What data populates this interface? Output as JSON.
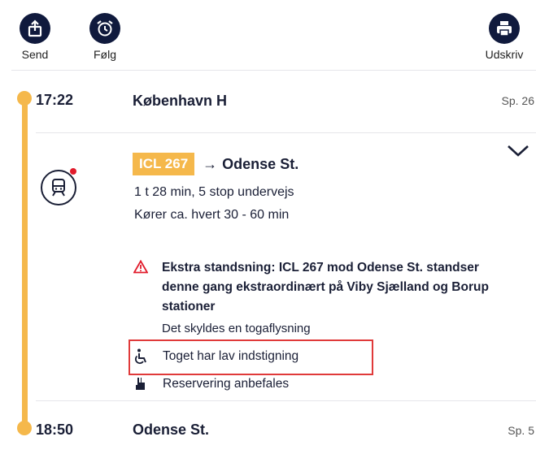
{
  "toolbar": {
    "send_label": "Send",
    "follow_label": "Følg",
    "print_label": "Udskriv"
  },
  "departure": {
    "time": "17:22",
    "station": "København H",
    "track": "Sp. 26"
  },
  "leg": {
    "train_badge": "ICL 267",
    "arrow": "→",
    "destination": "Odense St.",
    "duration": "1 t 28 min, 5 stop undervejs",
    "frequency": "Kører ca. hvert 30 - 60 min"
  },
  "notice": {
    "text": "Ekstra standsning: ICL 267 mod Odense St. standser denne gang ekstraordinært på Viby Sjælland og Borup stationer",
    "reason": "Det skyldes en togaflysning"
  },
  "info": {
    "low_floor": "Toget har lav indstigning",
    "reservation": "Reservering anbefales"
  },
  "arrival": {
    "time": "18:50",
    "station": "Odense St.",
    "track": "Sp. 5"
  },
  "colors": {
    "accent": "#f5b84b",
    "navy": "#101a3d",
    "alert": "#e11b2b",
    "highlight": "#e03a3a"
  },
  "icons": [
    "share-icon",
    "alarm-clock-icon",
    "printer-icon",
    "train-icon",
    "chevron-down-icon",
    "warning-icon",
    "wheelchair-icon",
    "reservation-icon"
  ]
}
